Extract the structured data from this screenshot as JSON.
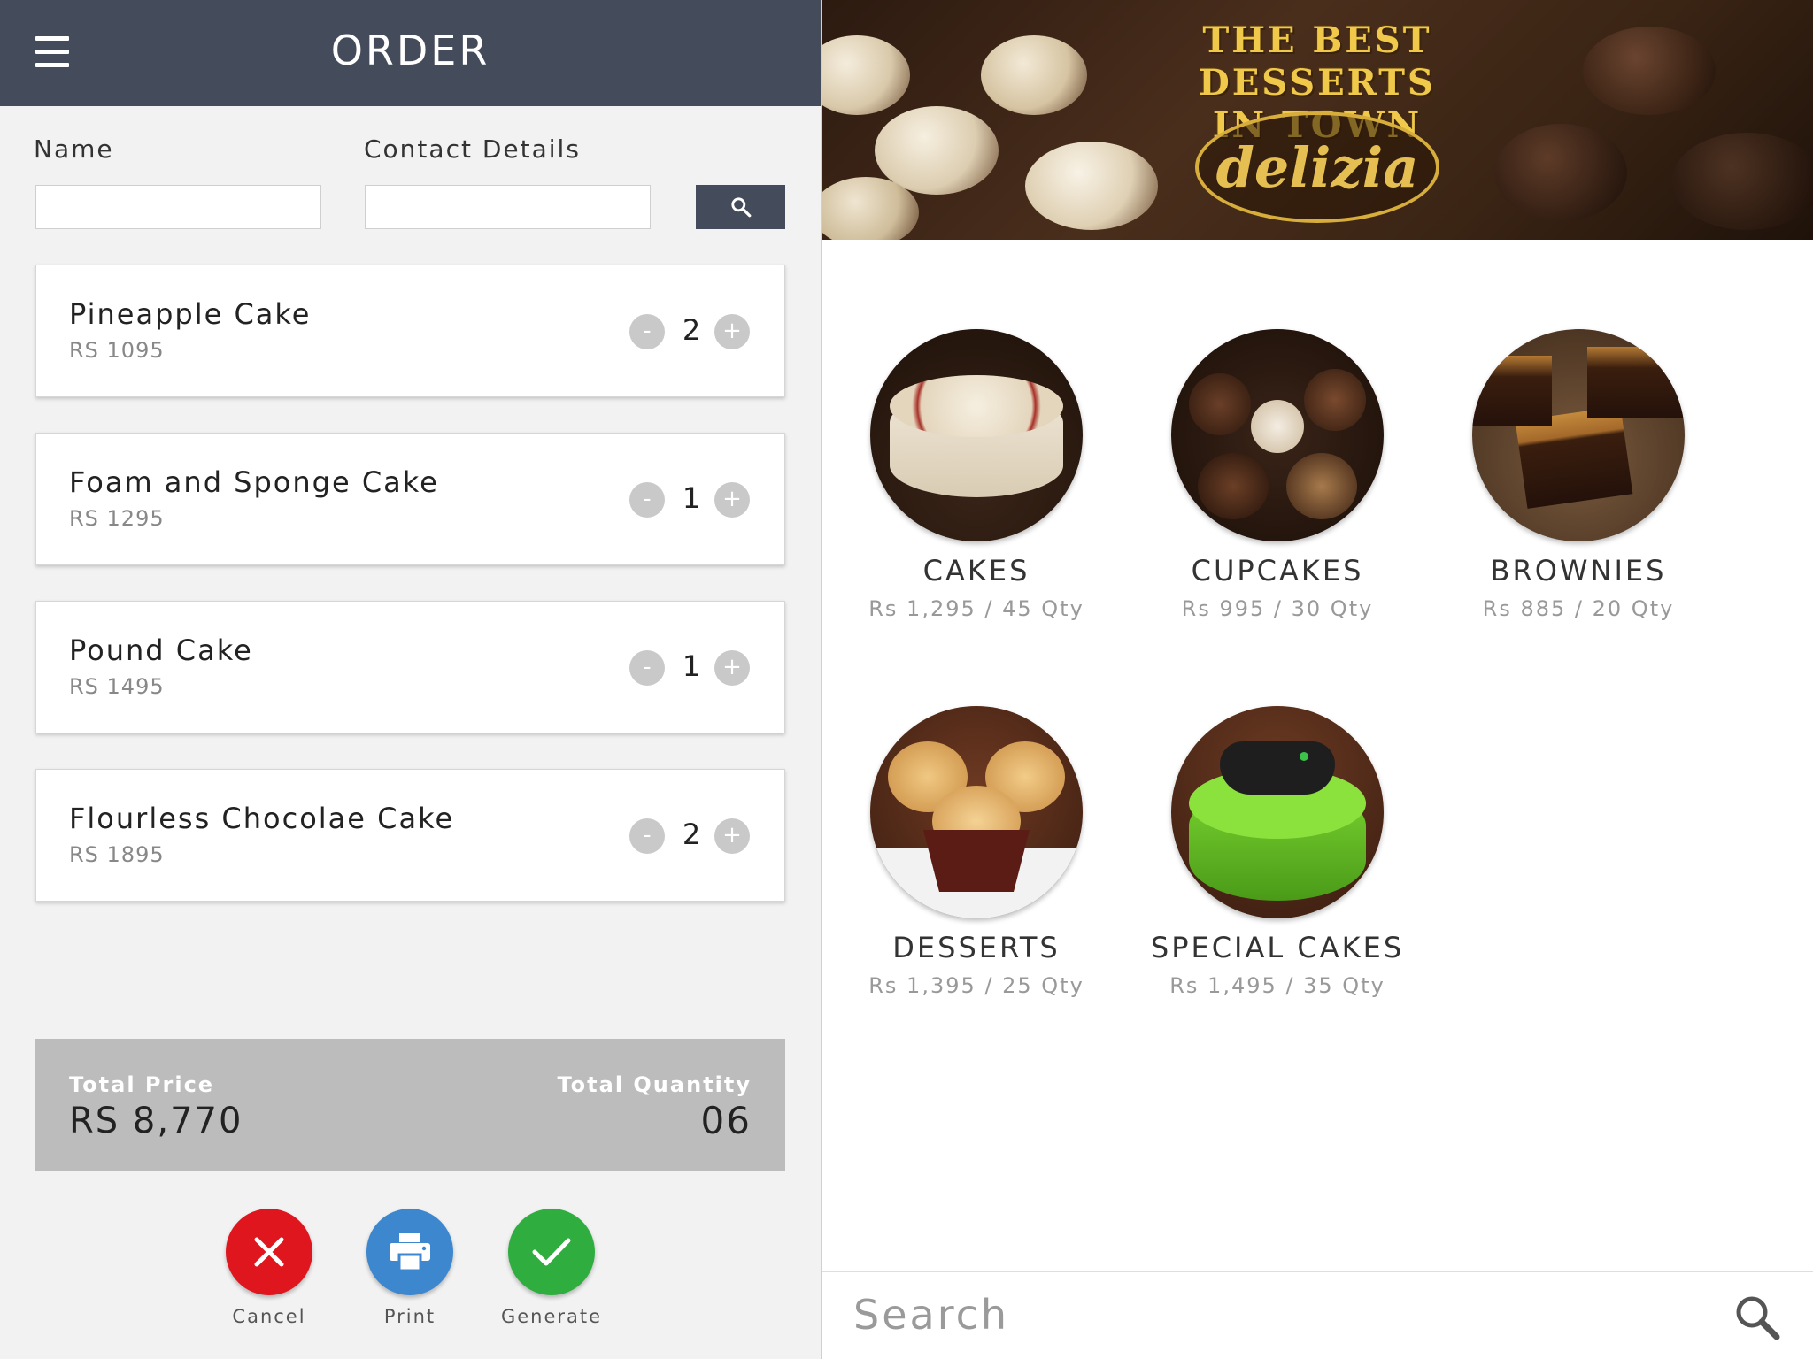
{
  "header": {
    "title": "ORDER",
    "menu_icon": "menu-icon"
  },
  "form": {
    "name_label": "Name",
    "name_value": "",
    "contact_label": "Contact Details",
    "contact_value": "",
    "search_icon": "search-icon"
  },
  "order_items": [
    {
      "name": "Pineapple Cake",
      "price": "RS 1095",
      "qty": "2"
    },
    {
      "name": "Foam and Sponge Cake",
      "price": "RS 1295",
      "qty": "1"
    },
    {
      "name": "Pound Cake",
      "price": "RS 1495",
      "qty": "1"
    },
    {
      "name": "Flourless Chocolae Cake",
      "price": "RS 1895",
      "qty": "2"
    }
  ],
  "qty_controls": {
    "minus": "-",
    "plus": "+"
  },
  "totals": {
    "price_label": "Total Price",
    "price_value": "RS 8,770",
    "qty_label": "Total Quantity",
    "qty_value": "06"
  },
  "actions": {
    "cancel": {
      "label": "Cancel",
      "color": "#e0161f",
      "icon": "close-icon"
    },
    "print": {
      "label": "Print",
      "color": "#3d87cf",
      "icon": "printer-icon"
    },
    "generate": {
      "label": "Generate",
      "color": "#2fae3f",
      "icon": "check-icon"
    }
  },
  "banner": {
    "tagline_line1": "THE BEST DESSERTS",
    "tagline_line2": "IN TOWN",
    "brand": "delizia"
  },
  "categories": [
    {
      "name": "CAKES",
      "info": "Rs 1,295 / 45 Qty",
      "image": "cake-image"
    },
    {
      "name": "CUPCAKES",
      "info": "Rs 995 / 30 Qty",
      "image": "cupcakes-image"
    },
    {
      "name": "BROWNIES",
      "info": "Rs 885 / 20 Qty",
      "image": "brownies-image"
    },
    {
      "name": "DESSERTS",
      "info": "Rs 1,395 / 25 Qty",
      "image": "muffins-image"
    },
    {
      "name": "SPECIAL CAKES",
      "info": "Rs 1,495 / 35 Qty",
      "image": "gaming-cake-image"
    }
  ],
  "search": {
    "placeholder": "Search",
    "icon": "search-icon"
  },
  "colors": {
    "header_bg": "#444b5b",
    "totals_bg": "#bcbcbc",
    "panel_bg": "#f2f2f2"
  }
}
